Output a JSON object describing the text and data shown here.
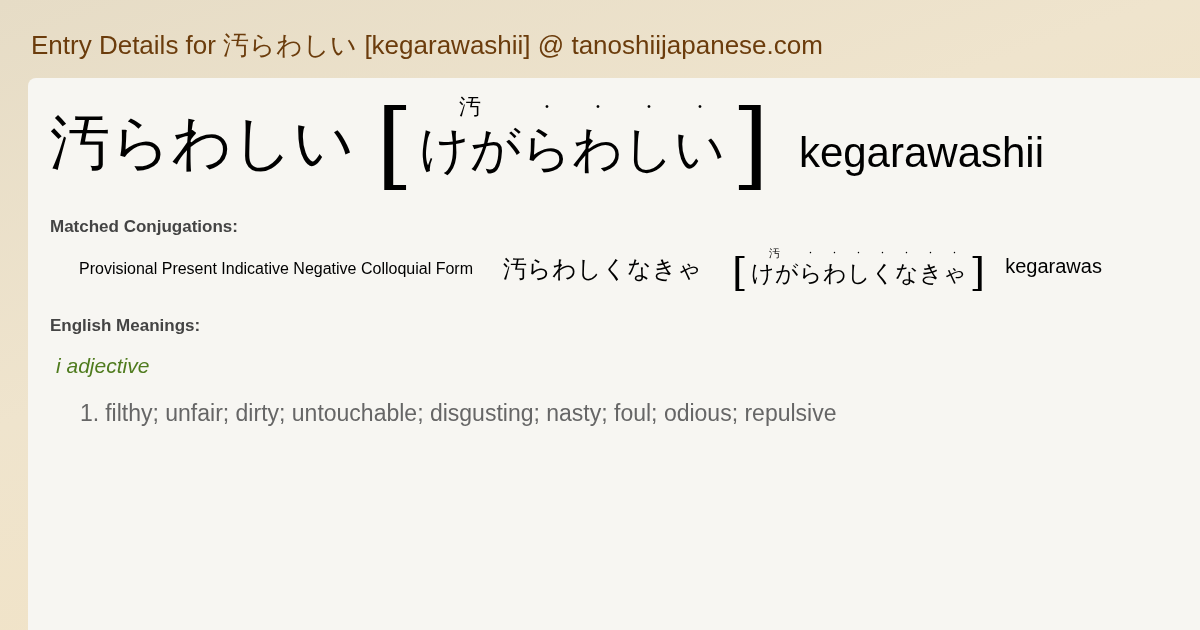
{
  "page_title": "Entry Details for 汚らわしい [kegarawashii] @ tanoshiijapanese.com",
  "entry": {
    "word": "汚らわしい",
    "open_bracket": "[",
    "furigana": [
      "汚",
      "·",
      "·",
      "·",
      "·"
    ],
    "reading": [
      "けが",
      "ら",
      "わ",
      "し",
      "い"
    ],
    "close_bracket": "]",
    "romaji": "kegarawashii"
  },
  "conjugations_heading": "Matched Conjugations:",
  "conjugations": [
    {
      "form": "Provisional Present Indicative Negative Colloquial Form",
      "word": "汚らわしくなきゃ",
      "open_bracket": "[",
      "furigana": [
        "汚",
        "·",
        "·",
        "·",
        "·",
        "·",
        "·",
        "·"
      ],
      "reading": [
        "けが",
        "ら",
        "わ",
        "し",
        "く",
        "な",
        "き",
        "ゃ"
      ],
      "close_bracket": "]",
      "romaji": "kegarawas"
    }
  ],
  "meanings_heading": "English Meanings:",
  "pos": "i adjective",
  "meanings": [
    {
      "number": "1.",
      "text": "filthy; unfair; dirty; untouchable; disgusting; nasty; foul; odious; repulsive"
    }
  ]
}
